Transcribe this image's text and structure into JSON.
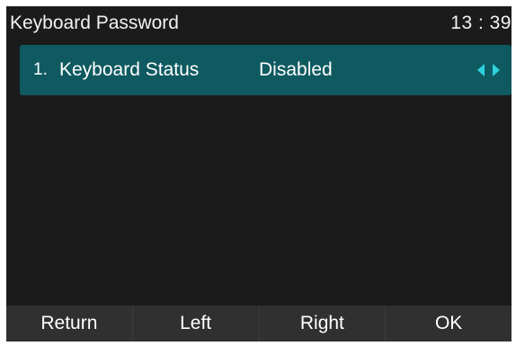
{
  "header": {
    "title": "Keyboard Password",
    "time": "13 : 39"
  },
  "list": {
    "items": [
      {
        "index": "1.",
        "label": "Keyboard Status",
        "value": "Disabled",
        "selected": true
      }
    ]
  },
  "softkeys": [
    {
      "label": "Return"
    },
    {
      "label": "Left"
    },
    {
      "label": "Right"
    },
    {
      "label": "OK"
    }
  ],
  "colors": {
    "background": "#1c1b1c",
    "selected_row": "#0f5a61",
    "arrow": "#2fd1de",
    "softkey_bar": "#303030",
    "text": "#ffffff"
  },
  "icons": {
    "left_arrow": "triangle-left-icon",
    "right_arrow": "triangle-right-icon"
  }
}
